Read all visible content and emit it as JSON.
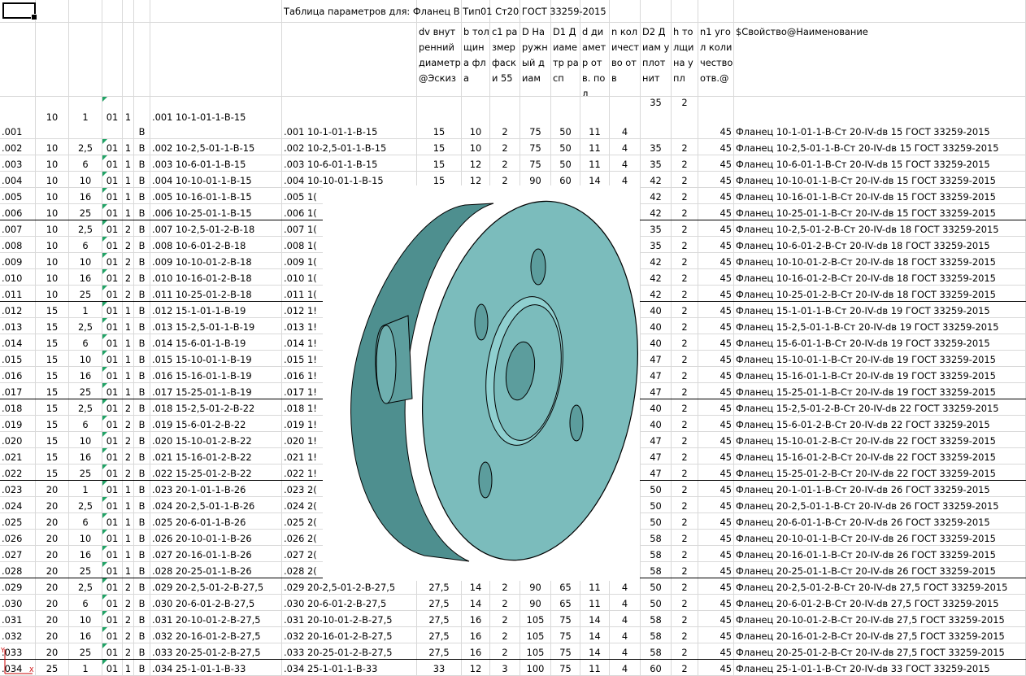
{
  "title_row": {
    "caption": "Таблица параметров для: Фланец В Тип01 Ст20 ГОСТ 33259-2015"
  },
  "headers": [
    {
      "key": "dv",
      "text": "dv внутренний диаметр@Эскиз"
    },
    {
      "key": "b",
      "text": "b толщина фла"
    },
    {
      "key": "c1",
      "text": "c1 размер фаски 55"
    },
    {
      "key": "D",
      "text": "D Наружный диам"
    },
    {
      "key": "D1",
      "text": "D1 Диаметр расп"
    },
    {
      "key": "d",
      "text": "d диаметр отв. под"
    },
    {
      "key": "n",
      "text": "n количество отв"
    },
    {
      "key": "D2",
      "text": "D2 Диам уплотнит"
    },
    {
      "key": "h",
      "text": "h толщина упл"
    },
    {
      "key": "n1",
      "text": "n1 угол количество отв.@"
    },
    {
      "key": "prop",
      "text": "$Свойство@Наименование"
    }
  ],
  "rows": [
    {
      "a": ".001",
      "b": "10",
      "c": "1",
      "d": "01",
      "e": "1",
      "f": "В",
      "g": ".001  10-1-01-1-В-15",
      "h": ".001  10-1-01-1-В-15",
      "i": "15",
      "j": "10",
      "k": "2",
      "l": "75",
      "m": "50",
      "n": "11",
      "o": "4",
      "p": "35",
      "q": "2",
      "r": "45",
      "s": "Фланец 10-1-01-1-В-Ст 20-IV-dв 15 ГОСТ 33259-2015"
    },
    {
      "a": ".002",
      "b": "10",
      "c": "2,5",
      "d": "01",
      "e": "1",
      "f": "В",
      "g": ".002  10-2,5-01-1-В-15",
      "h": ".002  10-2,5-01-1-В-15",
      "i": "15",
      "j": "10",
      "k": "2",
      "l": "75",
      "m": "50",
      "n": "11",
      "o": "4",
      "p": "35",
      "q": "2",
      "r": "45",
      "s": "Фланец 10-2,5-01-1-В-Ст 20-IV-dв 15 ГОСТ 33259-2015"
    },
    {
      "a": ".003",
      "b": "10",
      "c": "6",
      "d": "01",
      "e": "1",
      "f": "В",
      "g": ".003  10-6-01-1-В-15",
      "h": ".003  10-6-01-1-В-15",
      "i": "15",
      "j": "12",
      "k": "2",
      "l": "75",
      "m": "50",
      "n": "11",
      "o": "4",
      "p": "35",
      "q": "2",
      "r": "45",
      "s": "Фланец 10-6-01-1-В-Ст 20-IV-dв 15 ГОСТ 33259-2015"
    },
    {
      "a": ".004",
      "b": "10",
      "c": "10",
      "d": "01",
      "e": "1",
      "f": "В",
      "g": ".004  10-10-01-1-В-15",
      "h": ".004  10-10-01-1-В-15",
      "i": "15",
      "j": "12",
      "k": "2",
      "l": "90",
      "m": "60",
      "n": "14",
      "o": "4",
      "p": "42",
      "q": "2",
      "r": "45",
      "s": "Фланец 10-10-01-1-В-Ст 20-IV-dв 15 ГОСТ 33259-2015"
    },
    {
      "a": ".005",
      "b": "10",
      "c": "16",
      "d": "01",
      "e": "1",
      "f": "В",
      "g": ".005  10-16-01-1-В-15",
      "h": ".005  1(",
      "i": "",
      "j": "",
      "k": "",
      "l": "",
      "m": "",
      "n": "",
      "o": "",
      "p": "42",
      "q": "2",
      "r": "45",
      "s": "Фланец 10-16-01-1-В-Ст 20-IV-dв 15 ГОСТ 33259-2015"
    },
    {
      "a": ".006",
      "b": "10",
      "c": "25",
      "d": "01",
      "e": "1",
      "f": "В",
      "g": ".006  10-25-01-1-В-15",
      "h": ".006  1(",
      "i": "",
      "j": "",
      "k": "",
      "l": "",
      "m": "",
      "n": "",
      "o": "",
      "p": "42",
      "q": "2",
      "r": "45",
      "s": "Фланец 10-25-01-1-В-Ст 20-IV-dв 15 ГОСТ 33259-2015"
    },
    {
      "a": ".007",
      "b": "10",
      "c": "2,5",
      "d": "01",
      "e": "2",
      "f": "В",
      "g": ".007  10-2,5-01-2-В-18",
      "h": ".007  1(",
      "i": "",
      "j": "",
      "k": "",
      "l": "",
      "m": "",
      "n": "",
      "o": "",
      "p": "35",
      "q": "2",
      "r": "45",
      "s": "Фланец 10-2,5-01-2-В-Ст 20-IV-dв 18 ГОСТ 33259-2015"
    },
    {
      "a": ".008",
      "b": "10",
      "c": "6",
      "d": "01",
      "e": "2",
      "f": "В",
      "g": ".008  10-6-01-2-В-18",
      "h": ".008  1(",
      "i": "",
      "j": "",
      "k": "",
      "l": "",
      "m": "",
      "n": "",
      "o": "",
      "p": "35",
      "q": "2",
      "r": "45",
      "s": "Фланец 10-6-01-2-В-Ст 20-IV-dв 18 ГОСТ 33259-2015"
    },
    {
      "a": ".009",
      "b": "10",
      "c": "10",
      "d": "01",
      "e": "2",
      "f": "В",
      "g": ".009  10-10-01-2-В-18",
      "h": ".009  1(",
      "i": "",
      "j": "",
      "k": "",
      "l": "",
      "m": "",
      "n": "",
      "o": "",
      "p": "42",
      "q": "2",
      "r": "45",
      "s": "Фланец 10-10-01-2-В-Ст 20-IV-dв 18 ГОСТ 33259-2015"
    },
    {
      "a": ".010",
      "b": "10",
      "c": "16",
      "d": "01",
      "e": "2",
      "f": "В",
      "g": ".010  10-16-01-2-В-18",
      "h": ".010  1(",
      "i": "",
      "j": "",
      "k": "",
      "l": "",
      "m": "",
      "n": "",
      "o": "",
      "p": "42",
      "q": "2",
      "r": "45",
      "s": "Фланец 10-16-01-2-В-Ст 20-IV-dв 18 ГОСТ 33259-2015"
    },
    {
      "a": ".011",
      "b": "10",
      "c": "25",
      "d": "01",
      "e": "2",
      "f": "В",
      "g": ".011  10-25-01-2-В-18",
      "h": ".011  1(",
      "i": "",
      "j": "",
      "k": "",
      "l": "",
      "m": "",
      "n": "",
      "o": "",
      "p": "42",
      "q": "2",
      "r": "45",
      "s": "Фланец 10-25-01-2-В-Ст 20-IV-dв 18 ГОСТ 33259-2015"
    },
    {
      "a": ".012",
      "b": "15",
      "c": "1",
      "d": "01",
      "e": "1",
      "f": "В",
      "g": ".012  15-1-01-1-В-19",
      "h": ".012  1!",
      "i": "",
      "j": "",
      "k": "",
      "l": "",
      "m": "",
      "n": "",
      "o": "",
      "p": "40",
      "q": "2",
      "r": "45",
      "s": "Фланец 15-1-01-1-В-Ст 20-IV-dв 19 ГОСТ 33259-2015"
    },
    {
      "a": ".013",
      "b": "15",
      "c": "2,5",
      "d": "01",
      "e": "1",
      "f": "В",
      "g": ".013  15-2,5-01-1-В-19",
      "h": ".013  1!",
      "i": "",
      "j": "",
      "k": "",
      "l": "",
      "m": "",
      "n": "",
      "o": "",
      "p": "40",
      "q": "2",
      "r": "45",
      "s": "Фланец 15-2,5-01-1-В-Ст 20-IV-dв 19 ГОСТ 33259-2015"
    },
    {
      "a": ".014",
      "b": "15",
      "c": "6",
      "d": "01",
      "e": "1",
      "f": "В",
      "g": ".014  15-6-01-1-В-19",
      "h": ".014  1!",
      "i": "",
      "j": "",
      "k": "",
      "l": "",
      "m": "",
      "n": "",
      "o": "",
      "p": "40",
      "q": "2",
      "r": "45",
      "s": "Фланец 15-6-01-1-В-Ст 20-IV-dв 19 ГОСТ 33259-2015"
    },
    {
      "a": ".015",
      "b": "15",
      "c": "10",
      "d": "01",
      "e": "1",
      "f": "В",
      "g": ".015  15-10-01-1-В-19",
      "h": ".015  1!",
      "i": "",
      "j": "",
      "k": "",
      "l": "",
      "m": "",
      "n": "",
      "o": "",
      "p": "47",
      "q": "2",
      "r": "45",
      "s": "Фланец 15-10-01-1-В-Ст 20-IV-dв 19 ГОСТ 33259-2015"
    },
    {
      "a": ".016",
      "b": "15",
      "c": "16",
      "d": "01",
      "e": "1",
      "f": "В",
      "g": ".016  15-16-01-1-В-19",
      "h": ".016  1!",
      "i": "",
      "j": "",
      "k": "",
      "l": "",
      "m": "",
      "n": "",
      "o": "",
      "p": "47",
      "q": "2",
      "r": "45",
      "s": "Фланец 15-16-01-1-В-Ст 20-IV-dв 19 ГОСТ 33259-2015"
    },
    {
      "a": ".017",
      "b": "15",
      "c": "25",
      "d": "01",
      "e": "1",
      "f": "В",
      "g": ".017  15-25-01-1-В-19",
      "h": ".017  1!",
      "i": "",
      "j": "",
      "k": "",
      "l": "",
      "m": "",
      "n": "",
      "o": "",
      "p": "47",
      "q": "2",
      "r": "45",
      "s": "Фланец 15-25-01-1-В-Ст 20-IV-dв 19 ГОСТ 33259-2015"
    },
    {
      "a": ".018",
      "b": "15",
      "c": "2,5",
      "d": "01",
      "e": "2",
      "f": "В",
      "g": ".018  15-2,5-01-2-В-22",
      "h": ".018  1!",
      "i": "",
      "j": "",
      "k": "",
      "l": "",
      "m": "",
      "n": "",
      "o": "",
      "p": "40",
      "q": "2",
      "r": "45",
      "s": "Фланец 15-2,5-01-2-В-Ст 20-IV-dв 22 ГОСТ 33259-2015"
    },
    {
      "a": ".019",
      "b": "15",
      "c": "6",
      "d": "01",
      "e": "2",
      "f": "В",
      "g": ".019  15-6-01-2-В-22",
      "h": ".019  1!",
      "i": "",
      "j": "",
      "k": "",
      "l": "",
      "m": "",
      "n": "",
      "o": "",
      "p": "40",
      "q": "2",
      "r": "45",
      "s": "Фланец 15-6-01-2-В-Ст 20-IV-dв 22 ГОСТ 33259-2015"
    },
    {
      "a": ".020",
      "b": "15",
      "c": "10",
      "d": "01",
      "e": "2",
      "f": "В",
      "g": ".020  15-10-01-2-В-22",
      "h": ".020  1!",
      "i": "",
      "j": "",
      "k": "",
      "l": "",
      "m": "",
      "n": "",
      "o": "",
      "p": "47",
      "q": "2",
      "r": "45",
      "s": "Фланец 15-10-01-2-В-Ст 20-IV-dв 22 ГОСТ 33259-2015"
    },
    {
      "a": ".021",
      "b": "15",
      "c": "16",
      "d": "01",
      "e": "2",
      "f": "В",
      "g": ".021  15-16-01-2-В-22",
      "h": ".021  1!",
      "i": "",
      "j": "",
      "k": "",
      "l": "",
      "m": "",
      "n": "",
      "o": "",
      "p": "47",
      "q": "2",
      "r": "45",
      "s": "Фланец 15-16-01-2-В-Ст 20-IV-dв 22 ГОСТ 33259-2015"
    },
    {
      "a": ".022",
      "b": "15",
      "c": "25",
      "d": "01",
      "e": "2",
      "f": "В",
      "g": ".022  15-25-01-2-В-22",
      "h": ".022  1!",
      "i": "",
      "j": "",
      "k": "",
      "l": "",
      "m": "",
      "n": "",
      "o": "",
      "p": "47",
      "q": "2",
      "r": "45",
      "s": "Фланец 15-25-01-2-В-Ст 20-IV-dв 22 ГОСТ 33259-2015"
    },
    {
      "a": ".023",
      "b": "20",
      "c": "1",
      "d": "01",
      "e": "1",
      "f": "В",
      "g": ".023  20-1-01-1-В-26",
      "h": ".023  2(",
      "i": "",
      "j": "",
      "k": "",
      "l": "",
      "m": "",
      "n": "",
      "o": "",
      "p": "50",
      "q": "2",
      "r": "45",
      "s": "Фланец 20-1-01-1-В-Ст 20-IV-dв 26 ГОСТ 33259-2015"
    },
    {
      "a": ".024",
      "b": "20",
      "c": "2,5",
      "d": "01",
      "e": "1",
      "f": "В",
      "g": ".024  20-2,5-01-1-В-26",
      "h": ".024  2(",
      "i": "",
      "j": "",
      "k": "",
      "l": "",
      "m": "",
      "n": "",
      "o": "",
      "p": "50",
      "q": "2",
      "r": "45",
      "s": "Фланец 20-2,5-01-1-В-Ст 20-IV-dв 26 ГОСТ 33259-2015"
    },
    {
      "a": ".025",
      "b": "20",
      "c": "6",
      "d": "01",
      "e": "1",
      "f": "В",
      "g": ".025  20-6-01-1-В-26",
      "h": ".025  2(",
      "i": "",
      "j": "",
      "k": "",
      "l": "",
      "m": "",
      "n": "",
      "o": "",
      "p": "50",
      "q": "2",
      "r": "45",
      "s": "Фланец 20-6-01-1-В-Ст 20-IV-dв 26 ГОСТ 33259-2015"
    },
    {
      "a": ".026",
      "b": "20",
      "c": "10",
      "d": "01",
      "e": "1",
      "f": "В",
      "g": ".026  20-10-01-1-В-26",
      "h": ".026  2(",
      "i": "",
      "j": "",
      "k": "",
      "l": "",
      "m": "",
      "n": "",
      "o": "",
      "p": "58",
      "q": "2",
      "r": "45",
      "s": "Фланец 20-10-01-1-В-Ст 20-IV-dв 26 ГОСТ 33259-2015"
    },
    {
      "a": ".027",
      "b": "20",
      "c": "16",
      "d": "01",
      "e": "1",
      "f": "В",
      "g": ".027  20-16-01-1-В-26",
      "h": ".027  2(",
      "i": "",
      "j": "",
      "k": "",
      "l": "",
      "m": "",
      "n": "",
      "o": "",
      "p": "58",
      "q": "2",
      "r": "45",
      "s": "Фланец 20-16-01-1-В-Ст 20-IV-dв 26 ГОСТ 33259-2015"
    },
    {
      "a": ".028",
      "b": "20",
      "c": "25",
      "d": "01",
      "e": "1",
      "f": "В",
      "g": ".028  20-25-01-1-В-26",
      "h": ".028  2(",
      "i": "",
      "j": "",
      "k": "",
      "l": "",
      "m": "",
      "n": "",
      "o": "",
      "p": "58",
      "q": "2",
      "r": "45",
      "s": "Фланец 20-25-01-1-В-Ст 20-IV-dв 26 ГОСТ 33259-2015"
    },
    {
      "a": ".029",
      "b": "20",
      "c": "2,5",
      "d": "01",
      "e": "2",
      "f": "В",
      "g": ".029  20-2,5-01-2-В-27,5",
      "h": ".029  20-2,5-01-2-В-27,5",
      "i": "27,5",
      "j": "14",
      "k": "2",
      "l": "90",
      "m": "65",
      "n": "11",
      "o": "4",
      "p": "50",
      "q": "2",
      "r": "45",
      "s": "Фланец 20-2,5-01-2-В-Ст 20-IV-dв 27,5 ГОСТ 33259-2015"
    },
    {
      "a": ".030",
      "b": "20",
      "c": "6",
      "d": "01",
      "e": "2",
      "f": "В",
      "g": ".030  20-6-01-2-В-27,5",
      "h": ".030  20-6-01-2-В-27,5",
      "i": "27,5",
      "j": "14",
      "k": "2",
      "l": "90",
      "m": "65",
      "n": "11",
      "o": "4",
      "p": "50",
      "q": "2",
      "r": "45",
      "s": "Фланец 20-6-01-2-В-Ст 20-IV-dв 27,5 ГОСТ 33259-2015"
    },
    {
      "a": ".031",
      "b": "20",
      "c": "10",
      "d": "01",
      "e": "2",
      "f": "В",
      "g": ".031  20-10-01-2-В-27,5",
      "h": ".031  20-10-01-2-В-27,5",
      "i": "27,5",
      "j": "16",
      "k": "2",
      "l": "105",
      "m": "75",
      "n": "14",
      "o": "4",
      "p": "58",
      "q": "2",
      "r": "45",
      "s": "Фланец 20-10-01-2-В-Ст 20-IV-dв 27,5 ГОСТ 33259-2015"
    },
    {
      "a": ".032",
      "b": "20",
      "c": "16",
      "d": "01",
      "e": "2",
      "f": "В",
      "g": ".032  20-16-01-2-В-27,5",
      "h": ".032  20-16-01-2-В-27,5",
      "i": "27,5",
      "j": "16",
      "k": "2",
      "l": "105",
      "m": "75",
      "n": "14",
      "o": "4",
      "p": "58",
      "q": "2",
      "r": "45",
      "s": "Фланец 20-16-01-2-В-Ст 20-IV-dв 27,5 ГОСТ 33259-2015"
    },
    {
      "a": ".033",
      "b": "20",
      "c": "25",
      "d": "01",
      "e": "2",
      "f": "В",
      "g": ".033  20-25-01-2-В-27,5",
      "h": ".033  20-25-01-2-В-27,5",
      "i": "27,5",
      "j": "16",
      "k": "2",
      "l": "105",
      "m": "75",
      "n": "14",
      "o": "4",
      "p": "58",
      "q": "2",
      "r": "45",
      "s": "Фланец 20-25-01-2-В-Ст 20-IV-dв 27,5 ГОСТ 33259-2015"
    },
    {
      "a": ".034",
      "b": "25",
      "c": "1",
      "d": "01",
      "e": "1",
      "f": "В",
      "g": ".034  25-1-01-1-В-33",
      "h": ".034  25-1-01-1-В-33",
      "i": "33",
      "j": "12",
      "k": "3",
      "l": "100",
      "m": "75",
      "n": "11",
      "o": "4",
      "p": "60",
      "q": "2",
      "r": "45",
      "s": "Фланец 25-1-01-1-В-Ст 20-IV-dв 33 ГОСТ 33259-2015"
    }
  ],
  "separator_before": [
    ".007",
    ".012",
    ".018",
    ".023",
    ".029",
    ".034"
  ],
  "model_preview": {
    "name": "flange-3d-model",
    "fill_color": "#7bbcbc",
    "edge_color": "#000000"
  },
  "accent": {
    "selection_border": "#000000",
    "comment_marker": "#21a366",
    "grid_line": "#d9d9d9"
  }
}
